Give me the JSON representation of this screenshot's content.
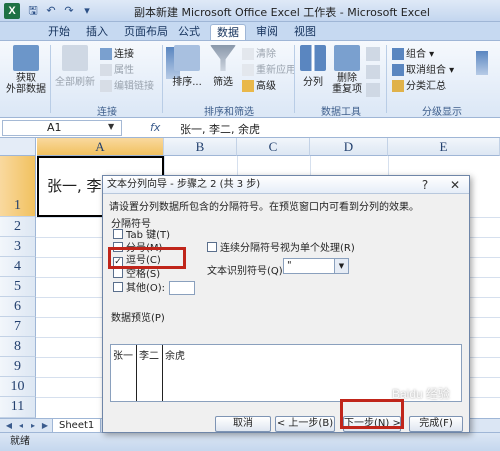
{
  "window": {
    "title": "副本新建 Microsoft Office Excel 工作表 - Microsoft Excel",
    "app_icon_label": "X"
  },
  "quick_access": [
    "save-icon",
    "undo-icon",
    "redo-icon",
    "customize-icon"
  ],
  "ribbon_tabs": [
    "开始",
    "插入",
    "页面布局",
    "公式",
    "数据",
    "审阅",
    "视图"
  ],
  "active_tab": "数据",
  "ribbon": {
    "get_external_data": "获取\n外部数据",
    "refresh_all": "全部刷新",
    "connections": "连接",
    "properties": "属性",
    "edit_links": "编辑链接",
    "group_connections": "连接",
    "sort": "排序...",
    "filter": "筛选",
    "clear": "清除",
    "reapply": "重新应用",
    "advanced": "高级",
    "group_sort_filter": "排序和筛选",
    "text_to_columns": "分列",
    "remove_duplicates": "删除\n重复项",
    "group_data_tools": "数据工具",
    "group": "组合",
    "ungroup": "取消组合",
    "subtotal": "分类汇总",
    "group_outline": "分级显示"
  },
  "formula_bar": {
    "name_box": "A1",
    "fx": "fx",
    "content": "张一, 李二, 余虎"
  },
  "columns": [
    "A",
    "B",
    "C",
    "D",
    "E"
  ],
  "rows": [
    "1",
    "2",
    "3",
    "4",
    "5",
    "6",
    "7",
    "8",
    "9",
    "10",
    "11"
  ],
  "cell_a1": "张一, 李",
  "sheet_tab": "Sheet1",
  "status": "就绪",
  "dialog": {
    "title": "文本分列向导 - 步骤之 2 (共 3 步)",
    "help": "?",
    "close": "✕",
    "description": "请设置分列数据所包含的分隔符号。在预览窗口内可看到分列的效果。",
    "delimiter_group": "分隔符号",
    "tab": "Tab 键(T)",
    "semicolon": "分号(M)",
    "comma": "逗号(C)",
    "space": "空格(S)",
    "other": "其他(O):",
    "consecutive": "连续分隔符号视为单个处理(R)",
    "qualifier_label": "文本识别符号(Q):",
    "qualifier_value": "\"",
    "preview_label": "数据预览(P)",
    "preview_cells": [
      "张一",
      "李二",
      "余虎"
    ],
    "btn_cancel": "取消",
    "btn_back": "< 上一步(B)",
    "btn_next": "下一步(N) >",
    "btn_finish": "完成(F)"
  },
  "watermark": "Baidu 经验"
}
